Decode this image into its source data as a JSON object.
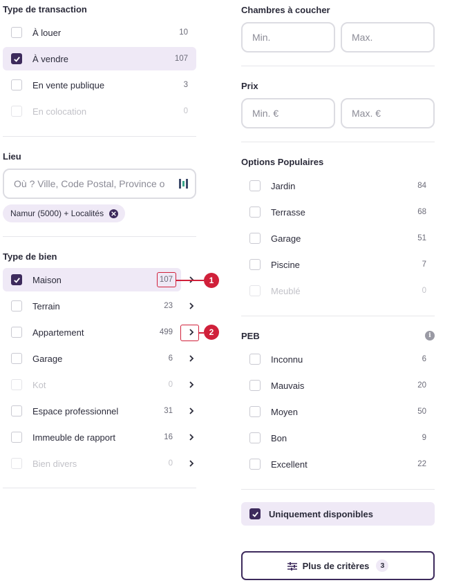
{
  "colors": {
    "accent": "#3d2a5c",
    "selected_bg": "#efe9f6",
    "annotation": "#d0203a"
  },
  "transaction": {
    "title": "Type de transaction",
    "items": [
      {
        "label": "À louer",
        "count": "10",
        "checked": false,
        "disabled": false
      },
      {
        "label": "À vendre",
        "count": "107",
        "checked": true,
        "disabled": false
      },
      {
        "label": "En vente publique",
        "count": "3",
        "checked": false,
        "disabled": false
      },
      {
        "label": "En colocation",
        "count": "0",
        "checked": false,
        "disabled": true
      }
    ]
  },
  "location": {
    "title": "Lieu",
    "placeholder": "Où ? Ville, Code Postal, Province o",
    "chip": "Namur (5000) + Localités"
  },
  "property_type": {
    "title": "Type de bien",
    "items": [
      {
        "label": "Maison",
        "count": "107",
        "checked": true,
        "disabled": false
      },
      {
        "label": "Terrain",
        "count": "23",
        "checked": false,
        "disabled": false
      },
      {
        "label": "Appartement",
        "count": "499",
        "checked": false,
        "disabled": false
      },
      {
        "label": "Garage",
        "count": "6",
        "checked": false,
        "disabled": false
      },
      {
        "label": "Kot",
        "count": "0",
        "checked": false,
        "disabled": true
      },
      {
        "label": "Espace professionnel",
        "count": "31",
        "checked": false,
        "disabled": false
      },
      {
        "label": "Immeuble de rapport",
        "count": "16",
        "checked": false,
        "disabled": false
      },
      {
        "label": "Bien divers",
        "count": "0",
        "checked": false,
        "disabled": true
      }
    ]
  },
  "annotations": {
    "one": "1",
    "two": "2"
  },
  "bedrooms": {
    "title": "Chambres à coucher",
    "min_placeholder": "Min.",
    "max_placeholder": "Max."
  },
  "price": {
    "title": "Prix",
    "min_placeholder": "Min. €",
    "max_placeholder": "Max. €"
  },
  "popular": {
    "title": "Options Populaires",
    "items": [
      {
        "label": "Jardin",
        "count": "84",
        "disabled": false
      },
      {
        "label": "Terrasse",
        "count": "68",
        "disabled": false
      },
      {
        "label": "Garage",
        "count": "51",
        "disabled": false
      },
      {
        "label": "Piscine",
        "count": "7",
        "disabled": false
      },
      {
        "label": "Meublé",
        "count": "0",
        "disabled": true
      }
    ]
  },
  "peb": {
    "title": "PEB",
    "info_icon": "info-icon",
    "items": [
      {
        "label": "Inconnu",
        "count": "6"
      },
      {
        "label": "Mauvais",
        "count": "20"
      },
      {
        "label": "Moyen",
        "count": "50"
      },
      {
        "label": "Bon",
        "count": "9"
      },
      {
        "label": "Excellent",
        "count": "22"
      }
    ]
  },
  "availability": {
    "label": "Uniquement disponibles",
    "checked": true
  },
  "more_button": {
    "label": "Plus de critères",
    "badge": "3"
  }
}
